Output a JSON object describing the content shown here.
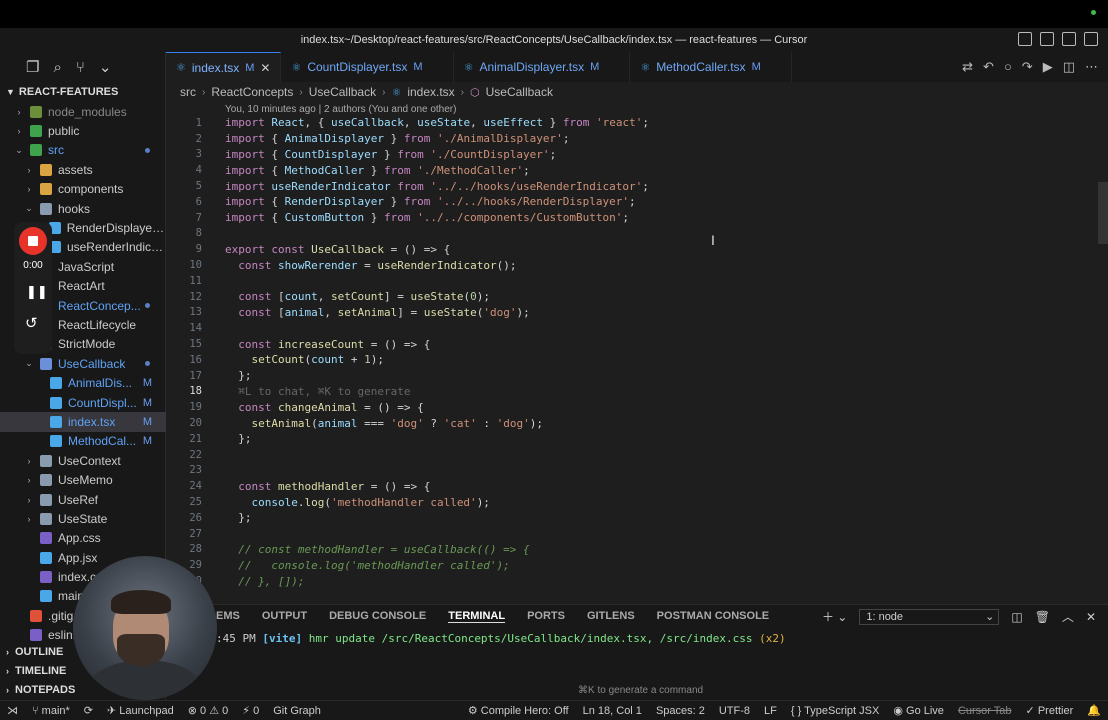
{
  "window": {
    "title": "index.tsx~/Desktop/react-features/src/ReactConcepts/UseCallback/index.tsx — react-features — Cursor"
  },
  "explorer": {
    "header": "REACT-FEATURES",
    "tree": [
      {
        "name": "node_modules",
        "indent": 1,
        "chev": ">",
        "icon": "#6b8f3b",
        "muted": true
      },
      {
        "name": "public",
        "indent": 1,
        "chev": ">",
        "icon": "#3fa34d"
      },
      {
        "name": "src",
        "indent": 1,
        "chev": "v",
        "icon": "#3fa34d",
        "blue": true,
        "dot": true
      },
      {
        "name": "assets",
        "indent": 2,
        "chev": ">",
        "icon": "#d9a441"
      },
      {
        "name": "components",
        "indent": 2,
        "chev": ">",
        "icon": "#d9a441"
      },
      {
        "name": "hooks",
        "indent": 2,
        "chev": "v",
        "icon": "#8a9bb0"
      },
      {
        "name": "RenderDisplayer.t...",
        "indent": 3,
        "chev": "",
        "icon": "#4aa8e8"
      },
      {
        "name": "useRenderIndicat...",
        "indent": 3,
        "chev": "",
        "icon": "#4aa8e8"
      },
      {
        "name": "JavaScript",
        "indent": 2,
        "chev": "",
        "icon": "#555"
      },
      {
        "name": "ReactArt",
        "indent": 2,
        "chev": "",
        "icon": "#555"
      },
      {
        "name": "ReactConcep...",
        "indent": 2,
        "chev": "",
        "icon": "#555",
        "blue": true,
        "dot": true
      },
      {
        "name": "ReactLifecycle",
        "indent": 2,
        "chev": "",
        "icon": "#555"
      },
      {
        "name": "StrictMode",
        "indent": 2,
        "chev": "",
        "icon": "#555"
      },
      {
        "name": "UseCallback",
        "indent": 2,
        "chev": "v",
        "icon": "#6b8fd8",
        "blue": true,
        "dot": true
      },
      {
        "name": "AnimalDis...",
        "indent": 3,
        "chev": "",
        "icon": "#4aa8e8",
        "blue": true,
        "mod": "M"
      },
      {
        "name": "CountDispl...",
        "indent": 3,
        "chev": "",
        "icon": "#4aa8e8",
        "blue": true,
        "mod": "M"
      },
      {
        "name": "index.tsx",
        "indent": 3,
        "chev": "",
        "icon": "#4aa8e8",
        "blue": true,
        "mod": "M",
        "selected": true
      },
      {
        "name": "MethodCal...",
        "indent": 3,
        "chev": "",
        "icon": "#4aa8e8",
        "blue": true,
        "mod": "M"
      },
      {
        "name": "UseContext",
        "indent": 2,
        "chev": ">",
        "icon": "#8a9bb0"
      },
      {
        "name": "UseMemo",
        "indent": 2,
        "chev": ">",
        "icon": "#8a9bb0"
      },
      {
        "name": "UseRef",
        "indent": 2,
        "chev": ">",
        "icon": "#8a9bb0"
      },
      {
        "name": "UseState",
        "indent": 2,
        "chev": ">",
        "icon": "#8a9bb0"
      },
      {
        "name": "App.css",
        "indent": 2,
        "chev": "",
        "icon": "#7a5fc6"
      },
      {
        "name": "App.jsx",
        "indent": 2,
        "chev": "",
        "icon": "#4aa8e8"
      },
      {
        "name": "index.c...",
        "indent": 2,
        "chev": "",
        "icon": "#7a5fc6"
      },
      {
        "name": "main...",
        "indent": 2,
        "chev": "",
        "icon": "#4aa8e8"
      },
      {
        "name": ".gitig...",
        "indent": 1,
        "chev": "",
        "icon": "#e0513a"
      },
      {
        "name": "eslin...",
        "indent": 1,
        "chev": "",
        "icon": "#7a5fc6"
      }
    ],
    "bottom_sections": [
      "OUTLINE",
      "TIMELINE",
      "NOTEPADS"
    ]
  },
  "recorder": {
    "time": "0:00"
  },
  "tabs": [
    {
      "label": "index.tsx",
      "mod": "M",
      "active": true
    },
    {
      "label": "CountDisplayer.tsx",
      "mod": "M"
    },
    {
      "label": "AnimalDisplayer.tsx",
      "mod": "M"
    },
    {
      "label": "MethodCaller.tsx",
      "mod": "M"
    }
  ],
  "breadcrumb": [
    "src",
    "ReactConcepts",
    "UseCallback",
    "index.tsx",
    "UseCallback"
  ],
  "blame": "You, 10 minutes ago | 2 authors (You and one other)",
  "code_lines": [
    {
      "n": "1",
      "html": "<span class='kw'>import</span> <span class='v'>React</span>, { <span class='v'>useCallback</span>, <span class='v'>useState</span>, <span class='v'>useEffect</span> } <span class='kw'>from</span> <span class='s'>'react'</span>;"
    },
    {
      "n": "2",
      "html": "<span class='kw'>import</span> { <span class='v'>AnimalDisplayer</span> } <span class='kw'>from</span> <span class='s'>'./AnimalDisplayer'</span>;"
    },
    {
      "n": "3",
      "html": "<span class='kw'>import</span> { <span class='v'>CountDisplayer</span> } <span class='kw'>from</span> <span class='s'>'./CountDisplayer'</span>;"
    },
    {
      "n": "4",
      "html": "<span class='kw'>import</span> { <span class='v'>MethodCaller</span> } <span class='kw'>from</span> <span class='s'>'./MethodCaller'</span>;"
    },
    {
      "n": "5",
      "html": "<span class='kw'>import</span> <span class='v'>useRenderIndicator</span> <span class='kw'>from</span> <span class='s'>'../../hooks/useRenderIndicator'</span>;"
    },
    {
      "n": "6",
      "html": "<span class='kw'>import</span> { <span class='v'>RenderDisplayer</span> } <span class='kw'>from</span> <span class='s'>'../../hooks/RenderDisplayer'</span>;"
    },
    {
      "n": "7",
      "html": "<span class='kw'>import</span> { <span class='v'>CustomButton</span> } <span class='kw'>from</span> <span class='s'>'../../components/CustomButton'</span>;"
    },
    {
      "n": "8",
      "html": ""
    },
    {
      "n": "9",
      "html": "<span class='kw'>export</span> <span class='kw'>const</span> <span class='f'>UseCallback</span> = () =&gt; {"
    },
    {
      "n": "10",
      "html": "  <span class='kw'>const</span> <span class='v'>showRerender</span> = <span class='f'>useRenderIndicator</span>();"
    },
    {
      "n": "11",
      "html": ""
    },
    {
      "n": "12",
      "html": "  <span class='kw'>const</span> [<span class='v'>count</span>, <span class='f'>setCount</span>] = <span class='f'>useState</span>(<span class='n'>0</span>);"
    },
    {
      "n": "13",
      "html": "  <span class='kw'>const</span> [<span class='v'>animal</span>, <span class='f'>setAnimal</span>] = <span class='f'>useState</span>(<span class='s'>'dog'</span>);"
    },
    {
      "n": "14",
      "html": ""
    },
    {
      "n": "15",
      "html": "  <span class='kw'>const</span> <span class='f'>increaseCount</span> = () =&gt; {"
    },
    {
      "n": "16",
      "html": "    <span class='f'>setCount</span>(<span class='v'>count</span> + <span class='n'>1</span>);"
    },
    {
      "n": "17",
      "html": "  };"
    },
    {
      "n": "18",
      "html": "  <span class='g'>⌘L to chat, ⌘K to generate</span>",
      "cur": true
    },
    {
      "n": "19",
      "html": "  <span class='kw'>const</span> <span class='f'>changeAnimal</span> = () =&gt; {"
    },
    {
      "n": "20",
      "html": "    <span class='f'>setAnimal</span>(<span class='v'>animal</span> === <span class='s'>'dog'</span> ? <span class='s'>'cat'</span> : <span class='s'>'dog'</span>);"
    },
    {
      "n": "21",
      "html": "  };"
    },
    {
      "n": "22",
      "html": ""
    },
    {
      "n": "23",
      "html": ""
    },
    {
      "n": "24",
      "html": "  <span class='kw'>const</span> <span class='f'>methodHandler</span> = () =&gt; {"
    },
    {
      "n": "25",
      "html": "    <span class='v'>console</span>.<span class='f'>log</span>(<span class='s'>'methodHandler called'</span>);"
    },
    {
      "n": "26",
      "html": "  };"
    },
    {
      "n": "27",
      "html": ""
    },
    {
      "n": "28",
      "html": "  <span class='c'>// const methodHandler = useCallback(() =&gt; {</span>"
    },
    {
      "n": "29",
      "html": "  <span class='c'>//   console.log('methodHandler called');</span>"
    },
    {
      "n": "30",
      "html": "  <span class='c'>// }, []);</span>"
    }
  ],
  "panel": {
    "tabs": [
      "EMS",
      "OUTPUT",
      "DEBUG CONSOLE",
      "TERMINAL",
      "PORTS",
      "GITLENS",
      "POSTMAN CONSOLE"
    ],
    "active_tab": "TERMINAL",
    "terminal_select": "1: node",
    "terminal_line_time": ":45 PM",
    "terminal_line_tag": "[vite]",
    "terminal_line_text": "hmr update /src/ReactConcepts/UseCallback/index.tsx, /src/index.css",
    "terminal_line_count": "(x2)",
    "hint": "⌘K to generate a command"
  },
  "status": {
    "branch": "main*",
    "launchpad": "Launchpad",
    "errors": "0",
    "warnings": "0",
    "ports": "0",
    "git_graph": "Git Graph",
    "compile_hero": "Compile Hero: Off",
    "position": "Ln 18, Col 1",
    "spaces": "Spaces: 2",
    "encoding": "UTF-8",
    "eol": "LF",
    "language": "TypeScript JSX",
    "go_live": "Go Live",
    "cursor_tab": "Cursor Tab",
    "prettier": "Prettier"
  }
}
